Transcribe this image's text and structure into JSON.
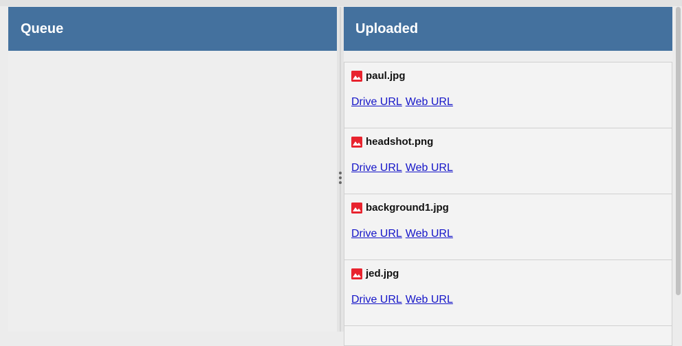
{
  "queue": {
    "title": "Queue"
  },
  "uploaded": {
    "title": "Uploaded",
    "files": [
      {
        "name": "paul.jpg",
        "drive_link": "Drive URL",
        "web_link": "Web URL"
      },
      {
        "name": "headshot.png",
        "drive_link": "Drive URL",
        "web_link": "Web URL"
      },
      {
        "name": "background1.jpg",
        "drive_link": "Drive URL",
        "web_link": "Web URL"
      },
      {
        "name": "jed.jpg",
        "drive_link": "Drive URL",
        "web_link": "Web URL"
      }
    ]
  },
  "icons": {
    "file_icon": "image-icon",
    "resize_handle": "vertical-dots-icon"
  },
  "colors": {
    "header_bg": "#44719e",
    "header_text": "#ffffff",
    "link": "#1515c8",
    "image_icon": "#e8232e"
  }
}
